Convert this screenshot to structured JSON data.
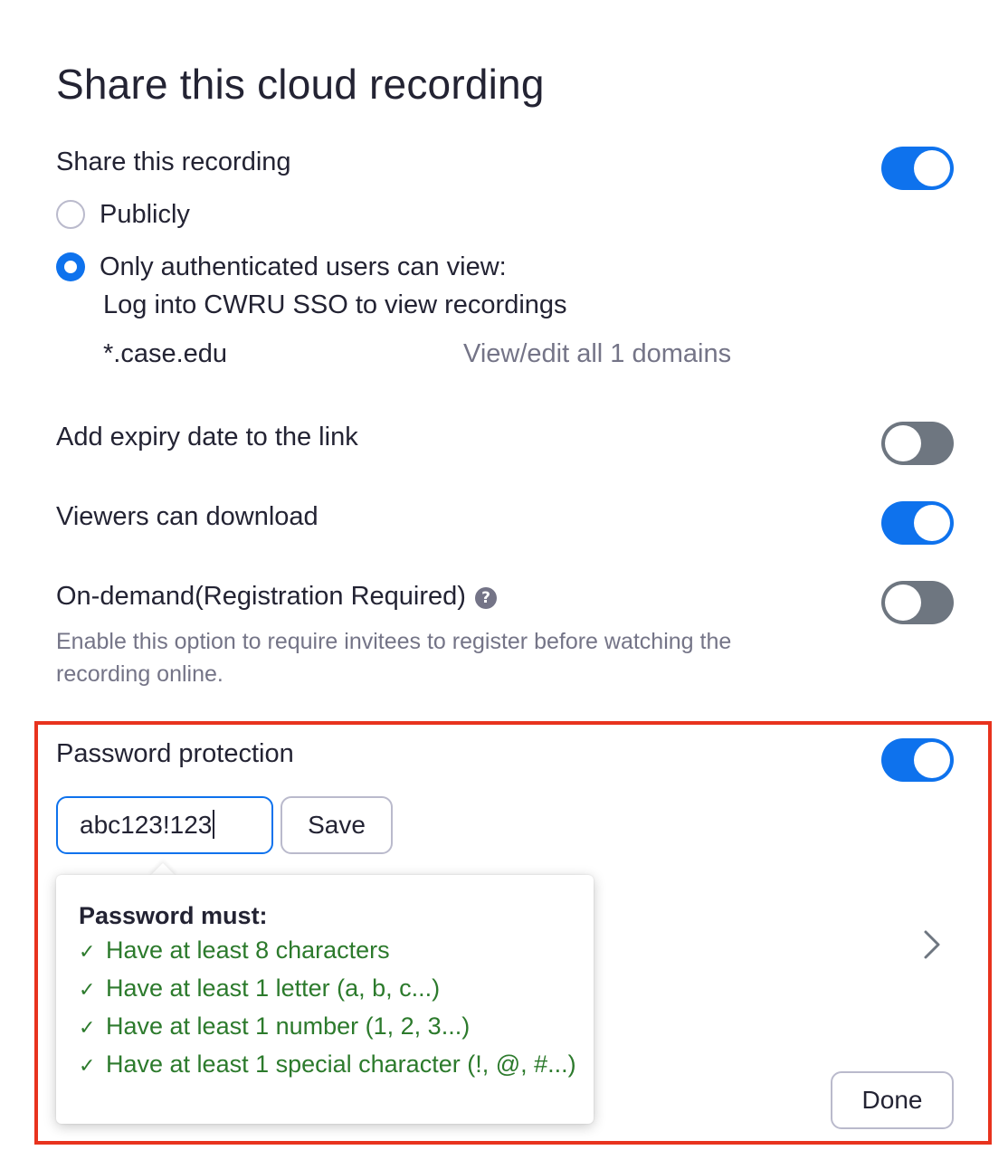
{
  "dialog": {
    "title": "Share this cloud recording"
  },
  "share": {
    "label": "Share this recording",
    "toggle_on": true,
    "options": [
      {
        "label": "Publicly",
        "selected": false
      },
      {
        "label": "Only authenticated users can view:",
        "selected": true
      }
    ],
    "auth_detail": "Log into CWRU SSO to view recordings",
    "domain": "*.case.edu",
    "view_domains_link": "View/edit all 1 domains"
  },
  "expiry": {
    "label": "Add expiry date to the link",
    "toggle_on": false
  },
  "download": {
    "label": "Viewers can download",
    "toggle_on": true
  },
  "on_demand": {
    "label": "On-demand(Registration Required)",
    "help_icon": "question-circle-icon",
    "description_line1": "Enable this option to require invitees to register before watching the",
    "description_line2": "recording online."
  },
  "password": {
    "label": "Password protection",
    "toggle_on": true,
    "value": "abc123!123",
    "save_label": "Save",
    "requirements": {
      "title": "Password must:",
      "check_icon": "checkmark-icon",
      "items": [
        "Have at least 8 characters",
        "Have at least 1 letter (a, b, c...)",
        "Have at least 1 number (1, 2, 3...)",
        "Have at least 1 special character (!, @, #...)"
      ]
    }
  },
  "footer": {
    "done_label": "Done"
  },
  "colors": {
    "accent": "#0e72ed",
    "toggle_off": "#6e7680",
    "success_text": "#2c7a2c",
    "highlight_border": "#e8331e",
    "muted_text": "#747487"
  }
}
